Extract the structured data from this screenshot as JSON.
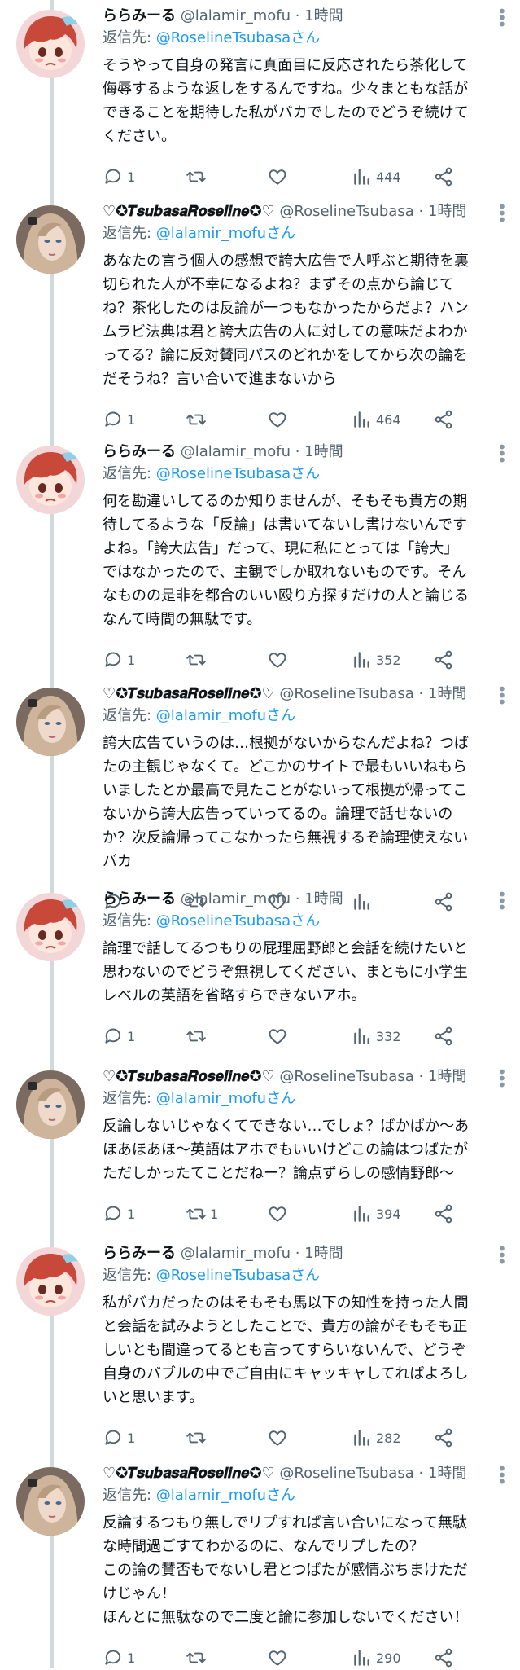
{
  "labels": {
    "reply_prefix": "返信先: ",
    "mention_suffix": "さん",
    "separator": " · "
  },
  "tweets": [
    {
      "name": "ららみーる",
      "handle": "@lalamir_mofu",
      "time": "1時間",
      "reply_to": "@RoselineTsubasa",
      "text": "そうやって自身の発言に真面目に反応されたら茶化して\n侮辱するような返しをするんですね。少々まともな話が\nできることを期待した私がバカでしたのでどうぞ続けて\nください。",
      "replies": "1",
      "retweets": "",
      "likes": "",
      "views": "444",
      "avatar": "red-hair-girl"
    },
    {
      "name": "♡✪𝑻𝒔𝒖𝒃𝒂𝒔𝒂𝑹𝒐𝒔𝒆𝒍𝒊𝒏𝒆✪♡",
      "handle": "@RoselineTsubasa",
      "time": "1時間",
      "reply_to": "@lalamir_mofu",
      "text": "あなたの言う個人の感想で誇大広告で人呼ぶと期待を裏\n切られた人が不幸になるよね？まずその点から論じて\nね？茶化したのは反論が一つもなかったからだよ？ハン\nムラビ法典は君と誇大広告の人に対しての意味だよわか\nってる？論に反対賛同パスのどれかをしてから次の論を\nだそうね？言い合いで進まないから",
      "replies": "1",
      "retweets": "",
      "likes": "",
      "views": "464",
      "avatar": "blonde-woman"
    },
    {
      "name": "ららみーる",
      "handle": "@lalamir_mofu",
      "time": "1時間",
      "reply_to": "@RoselineTsubasa",
      "text": "何を勘違いしてるのか知りませんが、そもそも貴方の期\n待してるような「反論」は書いてないし書けないんです\nよね。「誇大広告」だって、現に私にとっては「誇大」\nではなかったので、主観でしか取れないものです。そん\nなものの是非を都合のいい殴り方探すだけの人と論じる\nなんて時間の無駄です。",
      "replies": "1",
      "retweets": "",
      "likes": "",
      "views": "352",
      "avatar": "red-hair-girl"
    },
    {
      "name": "♡✪𝑻𝒔𝒖𝒃𝒂𝒔𝒂𝑹𝒐𝒔𝒆𝒍𝒊𝒏𝒆✪♡",
      "handle": "@RoselineTsubasa",
      "time": "1時間",
      "reply_to": "@lalamir_mofu",
      "text": "誇大広告ていうのは…根拠がないからなんだよね？つば\nたの主観じゃなくて。どこかのサイトで最もいいねもら\nいましたとか最高で見たことがないって根拠が帰ってこ\nないから誇大広告っていってるの。論理で話せないの\nか？次反論帰ってこなかったら無視するぞ論理使えない\nバカ",
      "replies": "",
      "retweets": "",
      "likes": "",
      "views": "",
      "avatar": "blonde-woman"
    },
    {
      "name": "ららみーる",
      "handle": "@lalamir_mofu",
      "time": "1時間",
      "reply_to": "@RoselineTsubasa",
      "text": "論理で話してるつもりの屁理屈野郎と会話を続けたいと\n思わないのでどうぞ無視してください、まともに小学生\nレベルの英語を省略すらできないアホ。",
      "replies": "1",
      "retweets": "",
      "likes": "",
      "views": "332",
      "avatar": "red-hair-girl"
    },
    {
      "name": "♡✪𝑻𝒔𝒖𝒃𝒂𝒔𝒂𝑹𝒐𝒔𝒆𝒍𝒊𝒏𝒆✪♡",
      "handle": "@RoselineTsubasa",
      "time": "1時間",
      "reply_to": "@lalamir_mofu",
      "text": "反論しないじゃなくてできない…でしょ？ばかばか～あ\nほあほあほ～英語はアホでもいいけどこの論はつばたが\nただしかったてことだねー？論点ずらしの感情野郎～",
      "replies": "1",
      "retweets": "1",
      "likes": "",
      "views": "394",
      "avatar": "blonde-woman"
    },
    {
      "name": "ららみーる",
      "handle": "@lalamir_mofu",
      "time": "1時間",
      "reply_to": "@RoselineTsubasa",
      "text": "私がバカだったのはそもそも馬以下の知性を持った人間\nと会話を試みようとしたことで、貴方の論がそもそも正\nしいとも間違ってるとも言ってすらいないんで、どうぞ\n自身のバブルの中でご自由にキャッキャしてればよろし\nいと思います。",
      "replies": "1",
      "retweets": "",
      "likes": "",
      "views": "282",
      "avatar": "red-hair-girl"
    },
    {
      "name": "♡✪𝑻𝒔𝒖𝒃𝒂𝒔𝒂𝑹𝒐𝒔𝒆𝒍𝒊𝒏𝒆✪♡",
      "handle": "@RoselineTsubasa",
      "time": "1時間",
      "reply_to": "@lalamir_mofu",
      "text": "反論するつもり無しでリプすれば言い合いになって無駄\nな時間過ごすてわかるのに、なんでリプしたの？\nこの論の賛否もでないし君とつばたが感情ぶちまけただ\nけじゃん！\nほんとに無駄なので二度と論に参加しないでください！",
      "replies": "1",
      "retweets": "",
      "likes": "",
      "views": "290",
      "avatar": "blonde-woman"
    }
  ]
}
